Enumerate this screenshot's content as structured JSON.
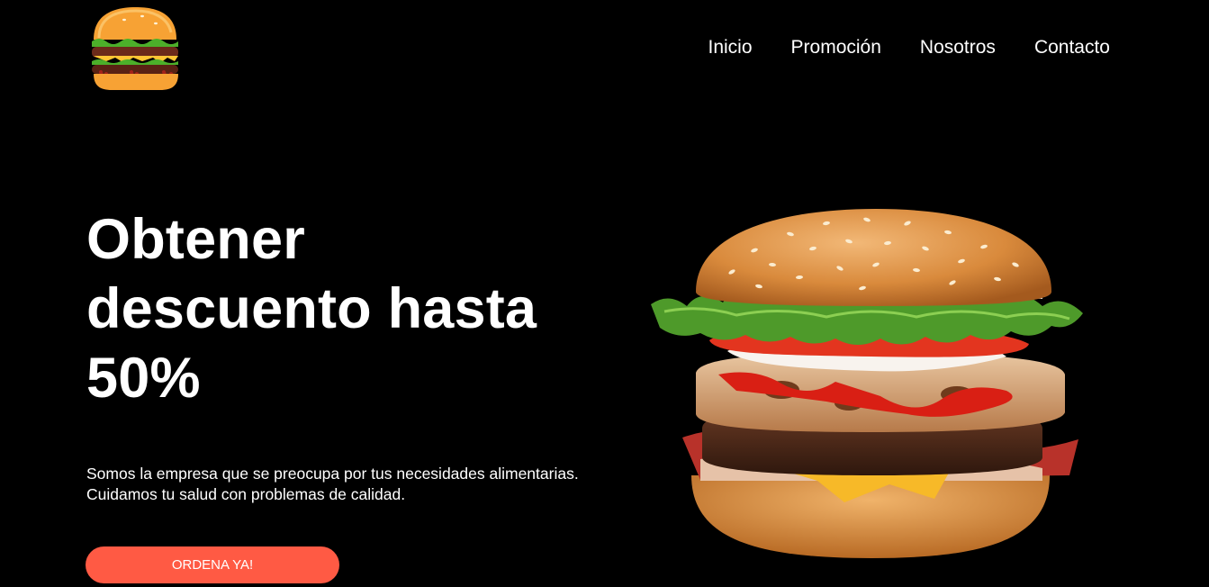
{
  "nav": {
    "items": [
      {
        "label": "Inicio"
      },
      {
        "label": "Promoción"
      },
      {
        "label": "Nosotros"
      },
      {
        "label": "Contacto"
      }
    ]
  },
  "hero": {
    "headline_line1": "Obtener",
    "headline_line2": "descuento hasta",
    "headline_line3": "50%",
    "description": "Somos la empresa que se preocupa por tus necesidades alimentarias. Cuidamos tu salud con problemas de calidad.",
    "cta_label": "ORDENA YA!"
  },
  "colors": {
    "background": "#000000",
    "text": "#ffffff",
    "accent": "#ff5a44"
  },
  "icons": {
    "logo": "burger-logo-icon",
    "hero": "burger-image"
  }
}
